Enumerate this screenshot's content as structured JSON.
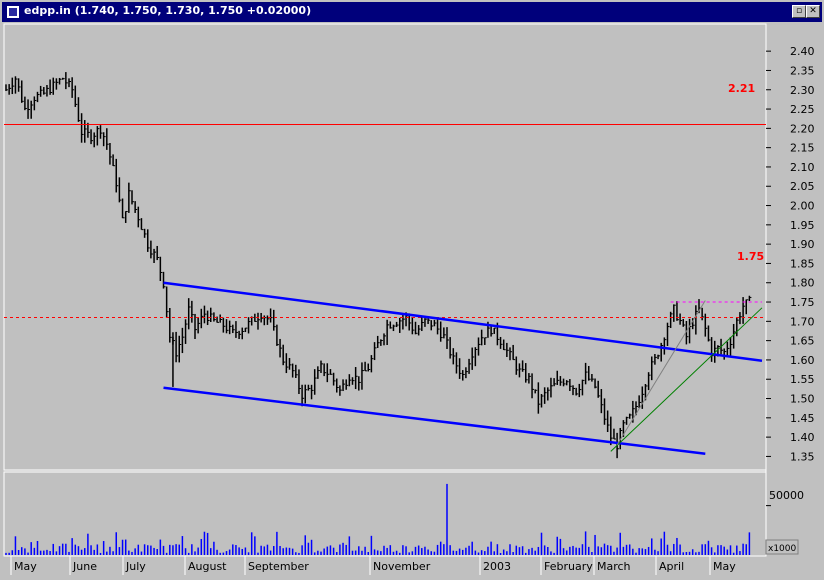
{
  "window": {
    "title": "edpp.in (1.740, 1.750, 1.730, 1.750 +0.02000)",
    "restore_icon": "restore-icon",
    "close_icon": "close-icon"
  },
  "colors": {
    "background": "#c0c0c0",
    "bars": "#000000",
    "channel": "#0000ff",
    "resistance": "#ff0000",
    "support_dashed": "#ff0000",
    "target_dashed": "#ff00ff",
    "uptrend_green": "#008000",
    "uptrend_gray": "#808080",
    "volume": "#0000ff",
    "label_red": "#ff0000"
  },
  "chart_data": [
    {
      "type": "ohlc",
      "title": "",
      "ylim": [
        1.32,
        2.46
      ],
      "y_ticks": [
        "2.40",
        "2.35",
        "2.30",
        "2.25",
        "2.20",
        "2.15",
        "2.10",
        "2.05",
        "2.00",
        "1.95",
        "1.90",
        "1.85",
        "1.80",
        "1.75",
        "1.70",
        "1.65",
        "1.60",
        "1.55",
        "1.50",
        "1.45",
        "1.40",
        "1.35"
      ],
      "x_labels": [
        "May",
        "June",
        "July",
        "August",
        "September",
        "November",
        "2003",
        "February",
        "March",
        "April",
        "May"
      ],
      "x_domain": [
        0,
        240
      ],
      "price_path": [
        [
          0,
          2.3
        ],
        [
          3,
          2.33
        ],
        [
          6,
          2.25
        ],
        [
          9,
          2.28
        ],
        [
          12,
          2.29
        ],
        [
          15,
          2.31
        ],
        [
          18,
          2.33
        ],
        [
          21,
          2.3
        ],
        [
          24,
          2.19
        ],
        [
          27,
          2.18
        ],
        [
          30,
          2.2
        ],
        [
          32,
          2.16
        ],
        [
          35,
          2.06
        ],
        [
          37,
          1.96
        ],
        [
          39,
          2.03
        ],
        [
          42,
          1.97
        ],
        [
          45,
          1.9
        ],
        [
          48,
          1.86
        ],
        [
          50,
          1.8
        ],
        [
          52,
          1.66
        ],
        [
          54,
          1.62
        ],
        [
          56,
          1.66
        ],
        [
          58,
          1.73
        ],
        [
          60,
          1.68
        ],
        [
          63,
          1.72
        ],
        [
          66,
          1.7
        ],
        [
          69,
          1.69
        ],
        [
          72,
          1.67
        ],
        [
          75,
          1.68
        ],
        [
          78,
          1.7
        ],
        [
          81,
          1.72
        ],
        [
          84,
          1.7
        ],
        [
          86,
          1.65
        ],
        [
          88,
          1.6
        ],
        [
          91,
          1.57
        ],
        [
          94,
          1.51
        ],
        [
          97,
          1.53
        ],
        [
          100,
          1.58
        ],
        [
          103,
          1.56
        ],
        [
          106,
          1.52
        ],
        [
          109,
          1.56
        ],
        [
          112,
          1.55
        ],
        [
          115,
          1.58
        ],
        [
          118,
          1.64
        ],
        [
          121,
          1.69
        ],
        [
          124,
          1.7
        ],
        [
          127,
          1.71
        ],
        [
          130,
          1.67
        ],
        [
          133,
          1.7
        ],
        [
          136,
          1.69
        ],
        [
          139,
          1.66
        ],
        [
          142,
          1.6
        ],
        [
          145,
          1.56
        ],
        [
          148,
          1.62
        ],
        [
          151,
          1.66
        ],
        [
          154,
          1.68
        ],
        [
          157,
          1.65
        ],
        [
          160,
          1.61
        ],
        [
          163,
          1.57
        ],
        [
          166,
          1.55
        ],
        [
          169,
          1.49
        ],
        [
          172,
          1.52
        ],
        [
          175,
          1.54
        ],
        [
          178,
          1.55
        ],
        [
          181,
          1.52
        ],
        [
          184,
          1.56
        ],
        [
          187,
          1.53
        ],
        [
          190,
          1.45
        ],
        [
          192,
          1.4
        ],
        [
          194,
          1.38
        ],
        [
          196,
          1.43
        ],
        [
          198,
          1.45
        ],
        [
          200,
          1.48
        ],
        [
          202,
          1.52
        ],
        [
          204,
          1.57
        ],
        [
          206,
          1.6
        ],
        [
          208,
          1.64
        ],
        [
          210,
          1.69
        ],
        [
          212,
          1.73
        ],
        [
          214,
          1.7
        ],
        [
          216,
          1.66
        ],
        [
          218,
          1.7
        ],
        [
          220,
          1.73
        ],
        [
          222,
          1.68
        ],
        [
          224,
          1.62
        ],
        [
          226,
          1.63
        ],
        [
          228,
          1.62
        ],
        [
          230,
          1.65
        ],
        [
          232,
          1.7
        ],
        [
          234,
          1.74
        ],
        [
          236,
          1.75
        ]
      ],
      "lines": {
        "resistance_221": {
          "y": 2.21,
          "label": "2.21"
        },
        "support_dashed_171": {
          "y": 1.71
        },
        "target_dashed_175": {
          "x_from": 211,
          "x_to": 240,
          "y": 1.75,
          "label": "1.75"
        },
        "channel_upper": {
          "x1": 50,
          "y1": 1.8,
          "x2": 240,
          "y2": 1.598
        },
        "channel_lower": {
          "x1": 50,
          "y1": 1.528,
          "x2": 222,
          "y2": 1.357
        },
        "uptrend_green": {
          "x1": 192,
          "y1": 1.363,
          "x2": 240,
          "y2": 1.735
        },
        "uptrend_gray": {
          "x1": 194,
          "y1": 1.38,
          "x2": 222,
          "y2": 1.754
        }
      }
    },
    {
      "type": "bar",
      "name": "volume",
      "y_tick": "50000",
      "y_unit": "x1000",
      "ylim": [
        0,
        80000
      ],
      "spike": {
        "x": 140,
        "value": 72000
      },
      "base_range": [
        2000,
        18000
      ]
    }
  ]
}
